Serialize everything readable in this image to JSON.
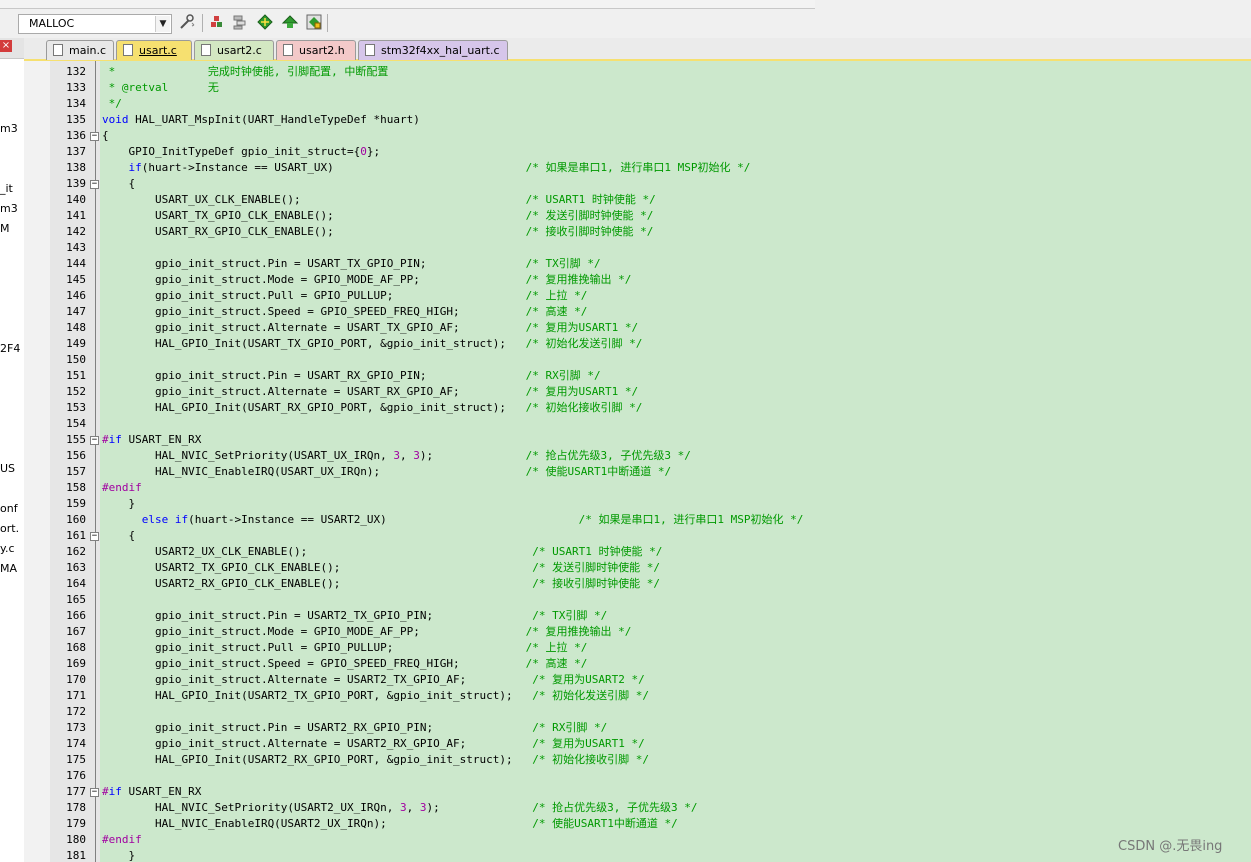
{
  "toolbar": {
    "target_name": "MALLOC",
    "buttons": [
      "target-options-icon",
      "load-icon",
      "manage-components-icon",
      "pack-installer-icon",
      "debug-icon",
      "select-software-icon"
    ]
  },
  "left_panel": {
    "fragments": [
      "m3",
      "_it",
      "m3",
      "M",
      "2F4",
      "US",
      "onf",
      "ort.",
      "y.c",
      "MA"
    ]
  },
  "tabs": [
    {
      "label": "main.c",
      "active": false,
      "color": "#e8e8e8"
    },
    {
      "label": "usart.c",
      "active": true,
      "color": "#f6e070"
    },
    {
      "label": "usart2.c",
      "active": false,
      "color": "#d3e7c2"
    },
    {
      "label": "usart2.h",
      "active": false,
      "color": "#f3c9c9"
    },
    {
      "label": "stm32f4xx_hal_uart.c",
      "active": false,
      "color": "#d6c6ea"
    }
  ],
  "editor": {
    "lines": [
      {
        "n": "132",
        "code": " *              ",
        "comment": "完成时钟使能, 引脚配置, 中断配置",
        "comment_col": 0,
        "fold": ""
      },
      {
        "n": "133",
        "code": " * @retval      ",
        "comment": "无",
        "comment_col": 0,
        "fold": ""
      },
      {
        "n": "134",
        "code": " */",
        "comment": "",
        "comment_col": 0,
        "fold": ""
      },
      {
        "n": "135",
        "code": "void HAL_UART_MspInit(UART_HandleTypeDef *huart)",
        "comment": "",
        "comment_col": 0,
        "fold": ""
      },
      {
        "n": "136",
        "code": "{",
        "comment": "",
        "comment_col": 0,
        "fold": "minus"
      },
      {
        "n": "137",
        "code": "    GPIO_InitTypeDef gpio_init_struct={0};",
        "comment": "",
        "comment_col": 0,
        "fold": ""
      },
      {
        "n": "138",
        "code": "    if(huart->Instance == USART_UX)",
        "comment": "/* 如果是串口1, 进行串口1 MSP初始化 */",
        "comment_col": 64,
        "fold": ""
      },
      {
        "n": "139",
        "code": "    {",
        "comment": "",
        "comment_col": 0,
        "fold": "minus"
      },
      {
        "n": "140",
        "code": "        USART_UX_CLK_ENABLE();",
        "comment": "/* USART1 时钟使能 */",
        "comment_col": 64,
        "fold": ""
      },
      {
        "n": "141",
        "code": "        USART_TX_GPIO_CLK_ENABLE();",
        "comment": "/* 发送引脚时钟使能 */",
        "comment_col": 64,
        "fold": ""
      },
      {
        "n": "142",
        "code": "        USART_RX_GPIO_CLK_ENABLE();",
        "comment": "/* 接收引脚时钟使能 */",
        "comment_col": 64,
        "fold": ""
      },
      {
        "n": "143",
        "code": "",
        "comment": "",
        "comment_col": 0,
        "fold": ""
      },
      {
        "n": "144",
        "code": "        gpio_init_struct.Pin = USART_TX_GPIO_PIN;",
        "comment": "/* TX引脚 */",
        "comment_col": 64,
        "fold": ""
      },
      {
        "n": "145",
        "code": "        gpio_init_struct.Mode = GPIO_MODE_AF_PP;",
        "comment": "/* 复用推挽输出 */",
        "comment_col": 64,
        "fold": ""
      },
      {
        "n": "146",
        "code": "        gpio_init_struct.Pull = GPIO_PULLUP;",
        "comment": "/* 上拉 */",
        "comment_col": 64,
        "fold": ""
      },
      {
        "n": "147",
        "code": "        gpio_init_struct.Speed = GPIO_SPEED_FREQ_HIGH;",
        "comment": "/* 高速 */",
        "comment_col": 64,
        "fold": ""
      },
      {
        "n": "148",
        "code": "        gpio_init_struct.Alternate = USART_TX_GPIO_AF;",
        "comment": "/* 复用为USART1 */",
        "comment_col": 64,
        "fold": ""
      },
      {
        "n": "149",
        "code": "        HAL_GPIO_Init(USART_TX_GPIO_PORT, &gpio_init_struct);",
        "comment": "/* 初始化发送引脚 */",
        "comment_col": 64,
        "fold": ""
      },
      {
        "n": "150",
        "code": "",
        "comment": "",
        "comment_col": 0,
        "fold": ""
      },
      {
        "n": "151",
        "code": "        gpio_init_struct.Pin = USART_RX_GPIO_PIN;",
        "comment": "/* RX引脚 */",
        "comment_col": 64,
        "fold": ""
      },
      {
        "n": "152",
        "code": "        gpio_init_struct.Alternate = USART_RX_GPIO_AF;",
        "comment": "/* 复用为USART1 */",
        "comment_col": 64,
        "fold": ""
      },
      {
        "n": "153",
        "code": "        HAL_GPIO_Init(USART_RX_GPIO_PORT, &gpio_init_struct);",
        "comment": "/* 初始化接收引脚 */",
        "comment_col": 64,
        "fold": ""
      },
      {
        "n": "154",
        "code": "",
        "comment": "",
        "comment_col": 0,
        "fold": ""
      },
      {
        "n": "155",
        "code": "#if USART_EN_RX",
        "comment": "",
        "comment_col": 0,
        "fold": "minus"
      },
      {
        "n": "156",
        "code": "        HAL_NVIC_SetPriority(USART_UX_IRQn, 3, 3);",
        "comment": "/* 抢占优先级3, 子优先级3 */",
        "comment_col": 64,
        "fold": ""
      },
      {
        "n": "157",
        "code": "        HAL_NVIC_EnableIRQ(USART_UX_IRQn);",
        "comment": "/* 使能USART1中断通道 */",
        "comment_col": 64,
        "fold": ""
      },
      {
        "n": "158",
        "code": "#endif",
        "comment": "",
        "comment_col": 0,
        "fold": ""
      },
      {
        "n": "159",
        "code": "    }",
        "comment": "",
        "comment_col": 0,
        "fold": ""
      },
      {
        "n": "160",
        "code": "      else if(huart->Instance == USART2_UX)",
        "comment": "/* 如果是串口1, 进行串口1 MSP初始化 */",
        "comment_col": 72,
        "fold": ""
      },
      {
        "n": "161",
        "code": "    {",
        "comment": "",
        "comment_col": 0,
        "fold": "minus"
      },
      {
        "n": "162",
        "code": "        USART2_UX_CLK_ENABLE();",
        "comment": "/* USART1 时钟使能 */",
        "comment_col": 65,
        "fold": ""
      },
      {
        "n": "163",
        "code": "        USART2_TX_GPIO_CLK_ENABLE();",
        "comment": "/* 发送引脚时钟使能 */",
        "comment_col": 65,
        "fold": ""
      },
      {
        "n": "164",
        "code": "        USART2_RX_GPIO_CLK_ENABLE();",
        "comment": "/* 接收引脚时钟使能 */",
        "comment_col": 65,
        "fold": ""
      },
      {
        "n": "165",
        "code": "",
        "comment": "",
        "comment_col": 0,
        "fold": ""
      },
      {
        "n": "166",
        "code": "        gpio_init_struct.Pin = USART2_TX_GPIO_PIN;",
        "comment": "/* TX引脚 */",
        "comment_col": 65,
        "fold": ""
      },
      {
        "n": "167",
        "code": "        gpio_init_struct.Mode = GPIO_MODE_AF_PP;",
        "comment": "/* 复用推挽输出 */",
        "comment_col": 64,
        "fold": ""
      },
      {
        "n": "168",
        "code": "        gpio_init_struct.Pull = GPIO_PULLUP;",
        "comment": "/* 上拉 */",
        "comment_col": 64,
        "fold": ""
      },
      {
        "n": "169",
        "code": "        gpio_init_struct.Speed = GPIO_SPEED_FREQ_HIGH;",
        "comment": "/* 高速 */",
        "comment_col": 64,
        "fold": ""
      },
      {
        "n": "170",
        "code": "        gpio_init_struct.Alternate = USART2_TX_GPIO_AF;",
        "comment": "/* 复用为USART2 */",
        "comment_col": 65,
        "fold": ""
      },
      {
        "n": "171",
        "code": "        HAL_GPIO_Init(USART2_TX_GPIO_PORT, &gpio_init_struct);",
        "comment": "/* 初始化发送引脚 */",
        "comment_col": 65,
        "fold": ""
      },
      {
        "n": "172",
        "code": "",
        "comment": "",
        "comment_col": 0,
        "fold": ""
      },
      {
        "n": "173",
        "code": "        gpio_init_struct.Pin = USART2_RX_GPIO_PIN;",
        "comment": "/* RX引脚 */",
        "comment_col": 65,
        "fold": ""
      },
      {
        "n": "174",
        "code": "        gpio_init_struct.Alternate = USART2_RX_GPIO_AF;",
        "comment": "/* 复用为USART1 */",
        "comment_col": 65,
        "fold": ""
      },
      {
        "n": "175",
        "code": "        HAL_GPIO_Init(USART2_RX_GPIO_PORT, &gpio_init_struct);",
        "comment": "/* 初始化接收引脚 */",
        "comment_col": 65,
        "fold": ""
      },
      {
        "n": "176",
        "code": "",
        "comment": "",
        "comment_col": 0,
        "fold": ""
      },
      {
        "n": "177",
        "code": "#if USART_EN_RX",
        "comment": "",
        "comment_col": 0,
        "fold": "minus"
      },
      {
        "n": "178",
        "code": "        HAL_NVIC_SetPriority(USART2_UX_IRQn, 3, 3);",
        "comment": "/* 抢占优先级3, 子优先级3 */",
        "comment_col": 65,
        "fold": ""
      },
      {
        "n": "179",
        "code": "        HAL_NVIC_EnableIRQ(USART2_UX_IRQn);",
        "comment": "/* 使能USART1中断通道 */",
        "comment_col": 65,
        "fold": ""
      },
      {
        "n": "180",
        "code": "#endif",
        "comment": "",
        "comment_col": 0,
        "fold": ""
      },
      {
        "n": "181",
        "code": "    }",
        "comment": "",
        "comment_col": 0,
        "fold": ""
      }
    ]
  },
  "watermark": "CSDN @.无畏ing"
}
